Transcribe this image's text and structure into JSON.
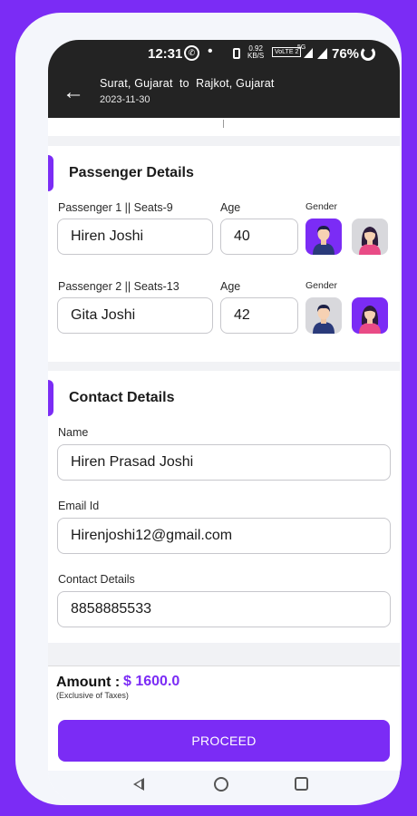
{
  "status_bar": {
    "time": "12:31",
    "dot": "•",
    "net_speed": "0.92",
    "net_speed_unit": "KB/S",
    "volte": "VoLTE 2",
    "network": "5G",
    "battery": "76%"
  },
  "app_bar": {
    "route_from": "Surat, Gujarat",
    "route_sep": "to",
    "route_to": "Rajkot, Gujarat",
    "date": "2023-11-30"
  },
  "passenger_section": {
    "title": "Passenger Details",
    "age_label": "Age",
    "gender_label": "Gender",
    "passengers": [
      {
        "label": "Passenger 1 || Seats-9",
        "name": "Hiren Joshi",
        "age": "40",
        "gender": "male"
      },
      {
        "label": "Passenger 2 || Seats-13",
        "name": "Gita Joshi",
        "age": "42",
        "gender": "female"
      }
    ]
  },
  "contact_section": {
    "title": "Contact Details",
    "name_label": "Name",
    "name_value": "Hiren Prasad Joshi",
    "email_label": "Email Id",
    "email_value": "Hirenjoshi12@gmail.com",
    "phone_label": "Contact Details",
    "phone_value": "8858885533"
  },
  "footer": {
    "amount_label": "Amount :",
    "amount_value": "$ 1600.0",
    "tax_note": "(Exclusive of Taxes)",
    "proceed_label": "PROCEED"
  },
  "colors": {
    "accent": "#7b2cf5",
    "app_bar": "#232323",
    "male_avatar_shirt": "#2a3a7a",
    "female_avatar_shirt": "#e94b86"
  },
  "icons": {
    "back": "arrow-left-icon",
    "male": "male-avatar-icon",
    "female": "female-avatar-icon",
    "nav_back": "triangle-back-icon",
    "nav_home": "circle-home-icon",
    "nav_recent": "square-recent-icon"
  }
}
